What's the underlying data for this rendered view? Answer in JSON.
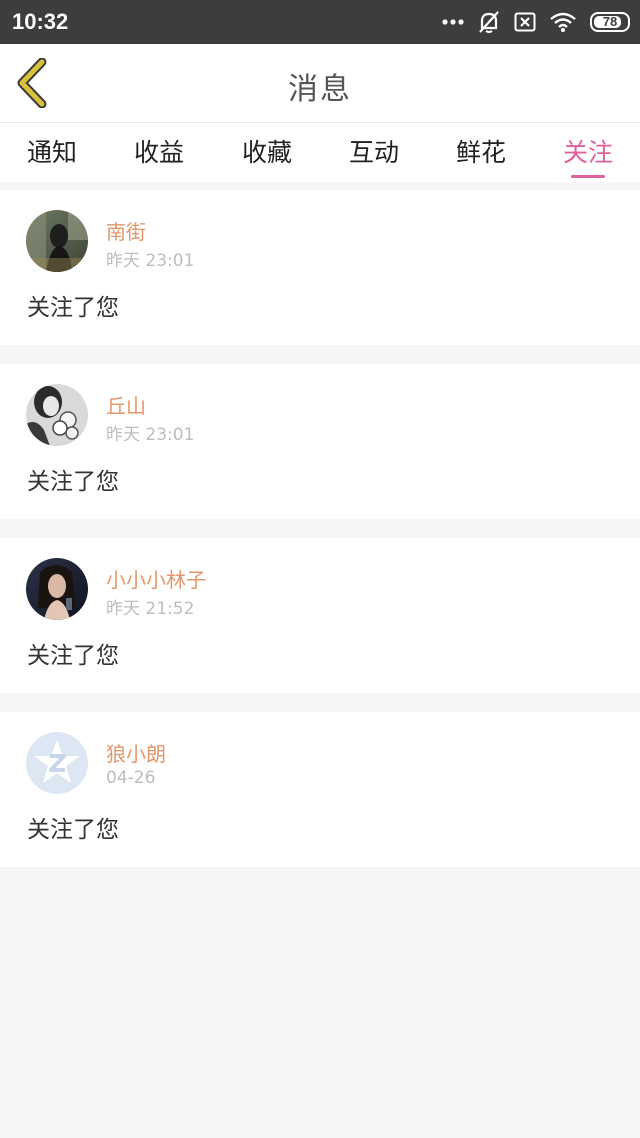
{
  "status_bar": {
    "time": "10:32",
    "icons": [
      "more-dots-icon",
      "notification-off-icon",
      "sim-off-icon",
      "wifi-icon"
    ],
    "battery": "78"
  },
  "header": {
    "title": "消息",
    "back_icon": "chevron-left-icon"
  },
  "tabs": [
    {
      "label": "通知",
      "active": false
    },
    {
      "label": "收益",
      "active": false
    },
    {
      "label": "收藏",
      "active": false
    },
    {
      "label": "互动",
      "active": false
    },
    {
      "label": "鲜花",
      "active": false
    },
    {
      "label": "关注",
      "active": true
    }
  ],
  "notifications": [
    {
      "user": "南街",
      "time": "昨天 23:01",
      "message": "关注了您"
    },
    {
      "user": "丘山",
      "time": "昨天 23:01",
      "message": "关注了您"
    },
    {
      "user": "小小小林子",
      "time": "昨天 21:52",
      "message": "关注了您"
    },
    {
      "user": "狼小朗",
      "time": "04-26",
      "message": "关注了您"
    }
  ],
  "colors": {
    "accent_pink": "#e0609e",
    "username_orange": "#e3976a",
    "back_icon_yellow": "#d9c23a",
    "status_bar_bg": "#3d3d3d",
    "page_bg": "#f7f5f5"
  }
}
